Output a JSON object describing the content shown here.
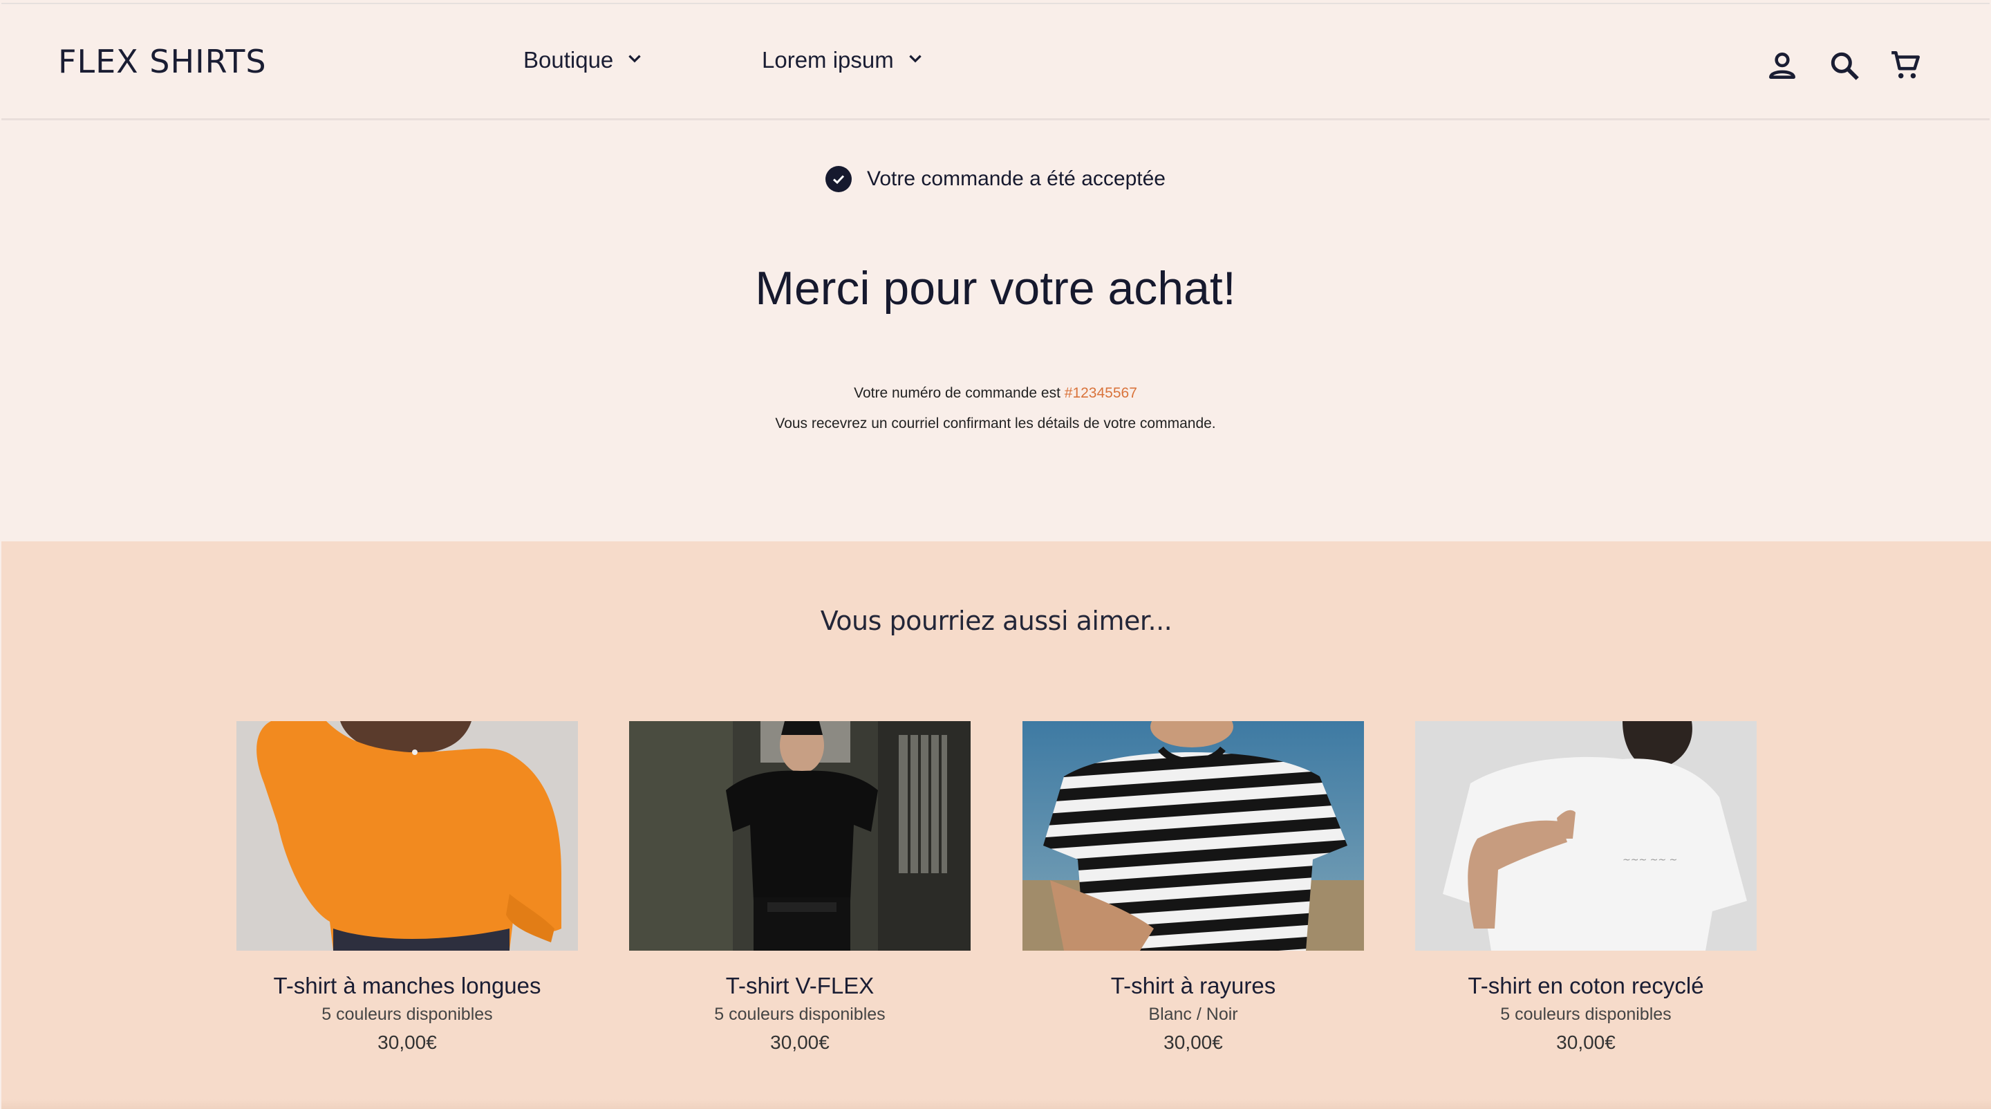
{
  "header": {
    "logo": "FLEX SHIRTS",
    "nav": [
      {
        "label": "Boutique"
      },
      {
        "label": "Lorem ipsum"
      }
    ],
    "icons": [
      "account-icon",
      "search-icon",
      "cart-icon"
    ]
  },
  "confirmation": {
    "notice": "Votre commande a été acceptée",
    "title": "Merci pour votre achat!",
    "order_prefix": "Votre numéro de commande est ",
    "order_number": "#12345567",
    "email_note": "Vous recevrez un courriel confirmant les détails de votre commande."
  },
  "recommendations": {
    "title": "Vous pourriez aussi aimer...",
    "products": [
      {
        "name": "T-shirt à manches longues",
        "subtitle": "5 couleurs disponibles",
        "price": "30,00€"
      },
      {
        "name": "T-shirt V-FLEX",
        "subtitle": "5 couleurs disponibles",
        "price": "30,00€"
      },
      {
        "name": "T-shirt à rayures",
        "subtitle": "Blanc / Noir",
        "price": "30,00€"
      },
      {
        "name": "T-shirt en coton recyclé",
        "subtitle": "5 couleurs disponibles",
        "price": "30,00€"
      }
    ]
  },
  "colors": {
    "background": "#f9eee9",
    "reco_background": "#f6dbca",
    "accent": "#d9733b",
    "text": "#16192e"
  }
}
